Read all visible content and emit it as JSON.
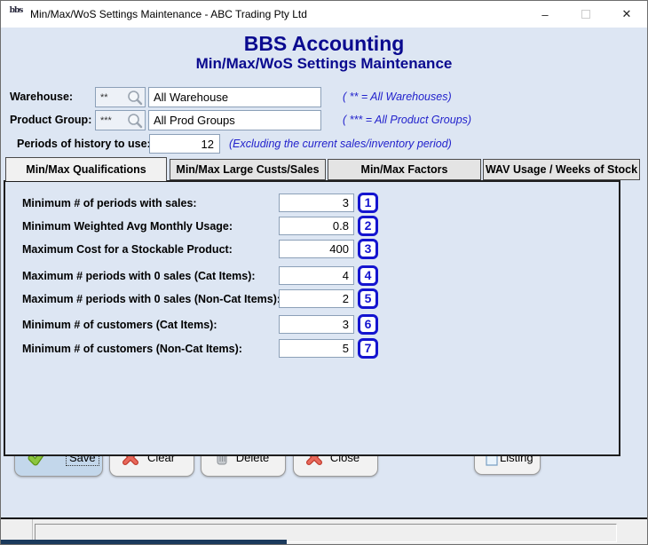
{
  "window": {
    "title": "Min/Max/WoS Settings Maintenance - ABC Trading Pty Ltd",
    "logo_text": "bbs",
    "minimize_glyph": "–",
    "close_glyph": "✕"
  },
  "header": {
    "app_title": "BBS Accounting",
    "screen_title": "Min/Max/WoS Settings Maintenance"
  },
  "filters": {
    "warehouse": {
      "label": "Warehouse:",
      "code": "**",
      "value": "All Warehouse",
      "hint": "( ** = All Warehouses)"
    },
    "product_group": {
      "label": "Product Group:",
      "code": "***",
      "value": "All Prod Groups",
      "hint": "( *** = All Product Groups)"
    },
    "periods": {
      "label": "Periods of history to use:",
      "value": "12",
      "hint": "(Excluding the current sales/inventory period)"
    }
  },
  "tabs": [
    {
      "label": "Min/Max Qualifications",
      "active": true
    },
    {
      "label": "Min/Max Large Custs/Sales",
      "active": false
    },
    {
      "label": "Min/Max Factors",
      "active": false
    },
    {
      "label": "WAV Usage / Weeks of Stock",
      "active": false
    }
  ],
  "fields": [
    {
      "label": "Minimum # of periods with sales:",
      "value": "3",
      "badge": "1"
    },
    {
      "label": "Minimum Weighted Avg Monthly Usage:",
      "value": "0.8",
      "badge": "2"
    },
    {
      "label": "Maximum Cost for a Stockable Product:",
      "value": "400",
      "badge": "3"
    },
    {
      "label": "Maximum # periods with 0 sales (Cat Items):",
      "value": "4",
      "badge": "4"
    },
    {
      "label": "Maximum # periods with 0 sales (Non-Cat Items):",
      "value": "2",
      "badge": "5"
    },
    {
      "label": "Minimum # of customers (Cat Items):",
      "value": "3",
      "badge": "6"
    },
    {
      "label": "Minimum # of customers (Non-Cat Items):",
      "value": "5",
      "badge": "7"
    }
  ],
  "buttons": {
    "save": "Save",
    "clear": "Clear",
    "delete": "Delete",
    "close": "Close",
    "listing": "Listing"
  },
  "colors": {
    "header_text": "#0a0a8f",
    "hint_text": "#2222cc",
    "badge_blue": "#1414cf",
    "main_bg": "#dde6f3",
    "save_button_bg": "#c3d7eb",
    "bottom_strip": "#1b3a5c"
  }
}
